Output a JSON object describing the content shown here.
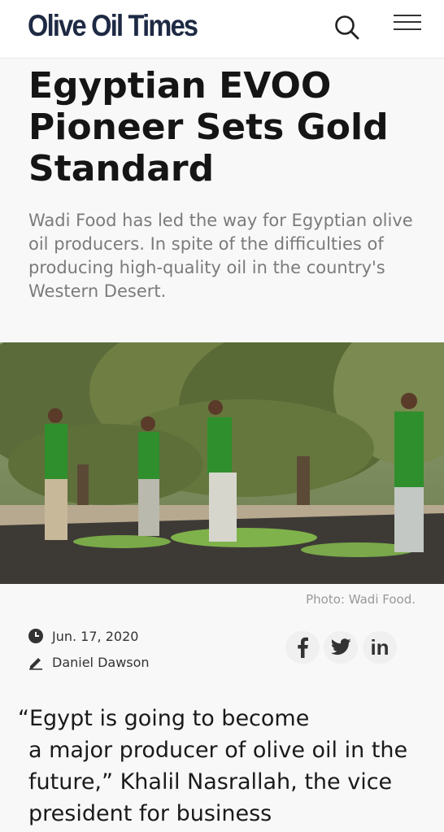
{
  "header": {
    "logo": "Olive Oil Times",
    "search_icon": "search-icon",
    "menu_icon": "hamburger-menu-icon"
  },
  "article": {
    "title": "Egyptian EVOO Pioneer Sets Gold Standard",
    "dek": "Wadi Food has led the way for Egyptian olive oil producers. In spite of the difficulties of producing high-quality oil in the country's Western Desert.",
    "photo_caption": "Photo: Wadi Food.",
    "date": "Jun. 17, 2020",
    "author": "Daniel Dawson",
    "body_first": "“Egypt is going to become",
    "body_rest": "a major producer of olive oil in the future,” Khalil Nasrallah, the vice president for business"
  },
  "social": {
    "facebook_icon": "facebook-icon",
    "twitter_icon": "twitter-icon",
    "linkedin_label": "in"
  },
  "colors": {
    "logo": "#1e2a44",
    "title": "#151515",
    "dek": "#7b7b7b",
    "green_shirt": "#2f8f2c"
  }
}
